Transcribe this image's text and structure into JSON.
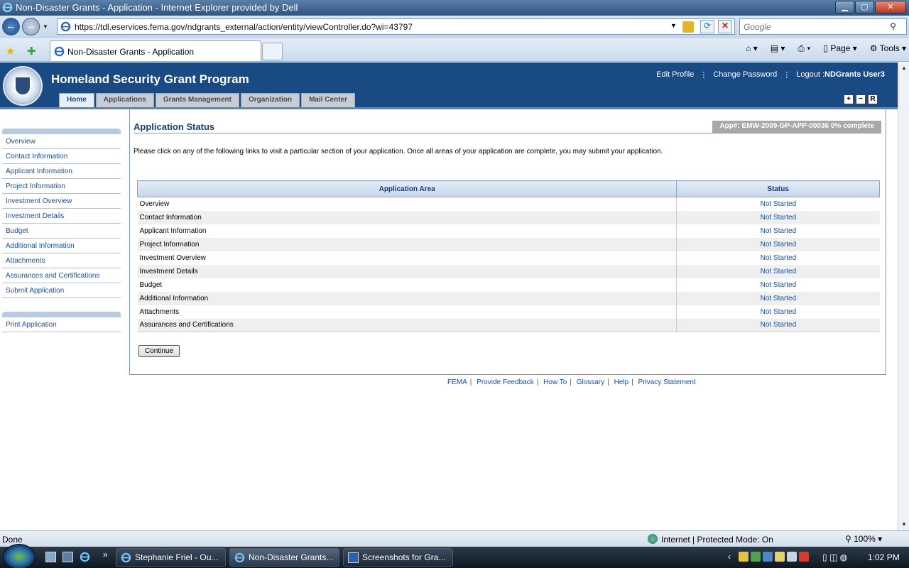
{
  "browser": {
    "window_title": "Non-Disaster Grants - Application - Internet Explorer provided by Dell",
    "url": "https://tdl.eservices.fema.gov/ndgrants_external/action/entity/viewController.do?wi=43797",
    "search_placeholder": "Google",
    "tab_title": "Non-Disaster Grants - Application",
    "commands": [
      "Page",
      "Tools"
    ],
    "status_text": "Done",
    "zone_text": "Internet | Protected Mode: On",
    "zoom": "100%"
  },
  "site": {
    "title": "Homeland Security Grant Program",
    "links": {
      "edit_profile": "Edit Profile",
      "change_password": "Change Password",
      "logout": "Logout :",
      "user": "NDGrants User3"
    },
    "tabs": [
      "Home",
      "Applications",
      "Grants Management",
      "Organization",
      "Mail Center"
    ],
    "controls": [
      "+",
      "−",
      "R"
    ]
  },
  "sidebar": {
    "items": [
      "Overview",
      "Contact Information",
      "Applicant Information",
      "Project Information",
      "Investment Overview",
      "Investment Details",
      "Budget",
      "Additional Information",
      "Attachments",
      "Assurances and Certifications",
      "Submit Application"
    ],
    "print": "Print Application"
  },
  "main": {
    "title": "Application Status",
    "app_number": "App#: EMW-2009-GP-APP-00036 0% complete",
    "intro": "Please click on any of the following links to visit a particular section of your application. Once all areas of your application are complete, you may submit your application.",
    "table": {
      "headers": [
        "Application Area",
        "Status"
      ],
      "rows": [
        [
          "Overview",
          "Not Started"
        ],
        [
          "Contact Information",
          "Not Started"
        ],
        [
          "Applicant Information",
          "Not Started"
        ],
        [
          "Project Information",
          "Not Started"
        ],
        [
          "Investment Overview",
          "Not Started"
        ],
        [
          "Investment Details",
          "Not Started"
        ],
        [
          "Budget",
          "Not Started"
        ],
        [
          "Additional Information",
          "Not Started"
        ],
        [
          "Attachments",
          "Not Started"
        ],
        [
          "Assurances and Certifications",
          "Not Started"
        ]
      ]
    },
    "continue": "Continue"
  },
  "footer": [
    "FEMA",
    "Provide Feedback",
    "How To",
    "Glossary",
    "Help",
    "Privacy Statement"
  ],
  "taskbar": {
    "buttons": [
      "Stephanie Friel - Ou...",
      "Non-Disaster Grants...",
      "Screenshots for Gra..."
    ],
    "clock": "1:02 PM"
  },
  "colors": {
    "header": "#1a4a84",
    "link": "#1a4fa0",
    "badge": "#a8a8a8"
  }
}
